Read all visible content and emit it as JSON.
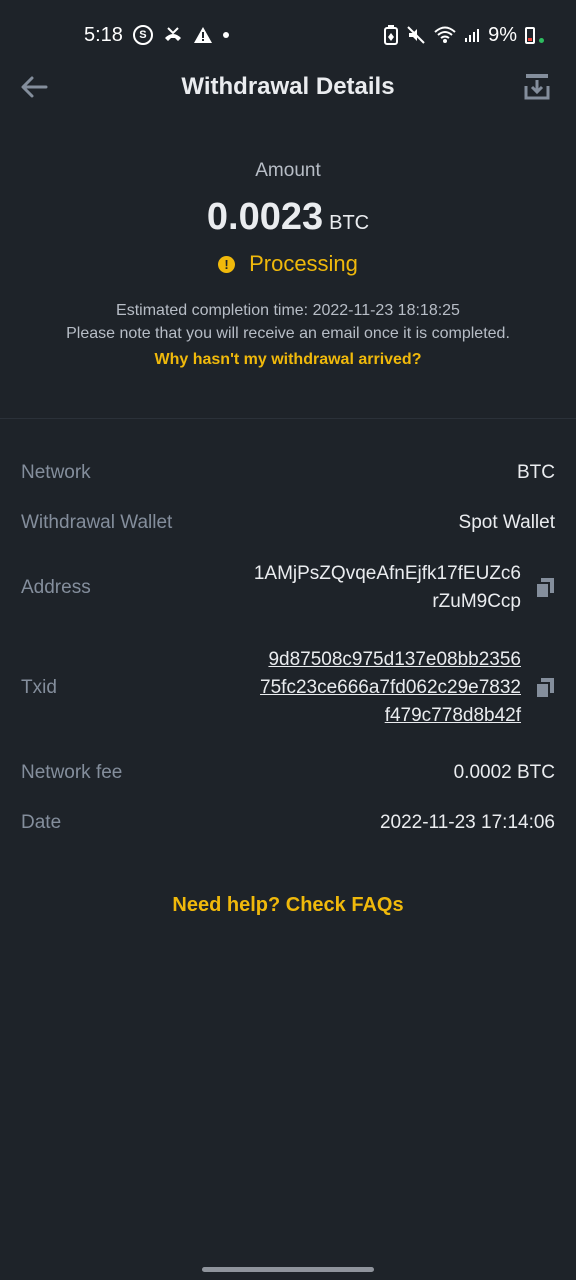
{
  "status_bar": {
    "time": "5:18",
    "battery": "9%"
  },
  "header": {
    "title": "Withdrawal Details"
  },
  "summary": {
    "amount_label": "Amount",
    "amount_value": "0.0023",
    "amount_unit": "BTC",
    "status": "Processing",
    "eta_line": "Estimated completion time: 2022-11-23 18:18:25",
    "note_line": "Please note that you will receive an email once it is completed.",
    "why_link": "Why hasn't my withdrawal arrived?"
  },
  "details": {
    "network": {
      "label": "Network",
      "value": "BTC"
    },
    "wallet": {
      "label": "Withdrawal Wallet",
      "value": "Spot Wallet"
    },
    "address": {
      "label": "Address",
      "line1": "1AMjPsZQvqeAfnEjfk17fEUZc6",
      "line2": "rZuM9Ccp"
    },
    "txid": {
      "label": "Txid",
      "line1": "9d87508c975d137e08bb2356",
      "line2": "75fc23ce666a7fd062c29e7832",
      "line3": "f479c778d8b42f"
    },
    "fee": {
      "label": "Network fee",
      "value": "0.0002 BTC"
    },
    "date": {
      "label": "Date",
      "value": "2022-11-23 17:14:06"
    }
  },
  "help_link": "Need help? Check FAQs",
  "colors": {
    "background": "#1e2329",
    "accent": "#f0b90b",
    "text_primary": "#eaecef",
    "text_secondary": "#848e9c"
  },
  "icons": {
    "back": "arrow-left-icon",
    "export": "download-tray-icon",
    "copy": "copy-icon",
    "status": "exclamation-circle-icon"
  }
}
